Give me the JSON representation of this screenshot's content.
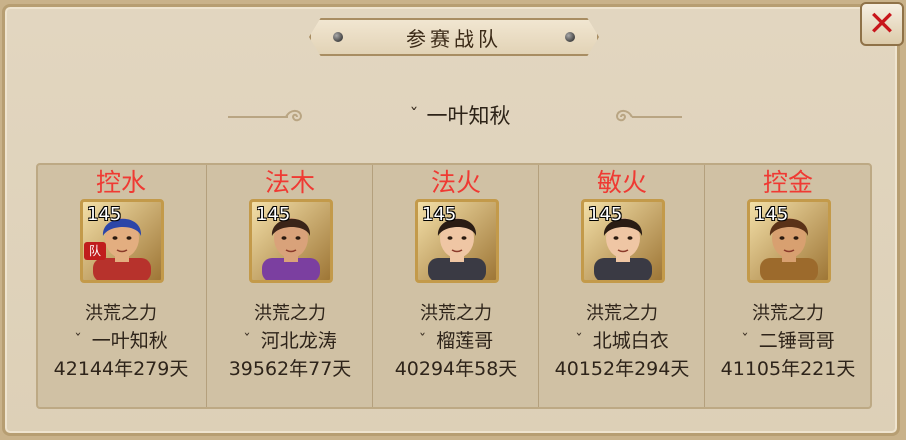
{
  "window": {
    "title": "参赛战队",
    "close_icon": "close-x-icon",
    "colors": {
      "accent": "#c8161c",
      "role_text": "#ef3a33",
      "panel_bg": "#ddd0b7"
    }
  },
  "team": {
    "flag_icon": "team-flag-icon",
    "name": "一叶知秋"
  },
  "members": [
    {
      "role": "控水",
      "level": "145",
      "badge": "队",
      "guild": "洪荒之力",
      "name": "一叶知秋",
      "time": "42144年279天",
      "hair": "#2c46a8",
      "skin": "#e3ae80",
      "robe": "#b7322c"
    },
    {
      "role": "法木",
      "level": "145",
      "guild": "洪荒之力",
      "name": "河北龙涛",
      "time": "39562年77天",
      "hair": "#3a2418",
      "skin": "#d9a27a",
      "robe": "#7b3fa0"
    },
    {
      "role": "法火",
      "level": "145",
      "guild": "洪荒之力",
      "name": "榴莲哥",
      "time": "40294年58天",
      "hair": "#2a1c14",
      "skin": "#efc6a4",
      "robe": "#3a3a44"
    },
    {
      "role": "敏火",
      "level": "145",
      "guild": "洪荒之力",
      "name": "北城白衣",
      "time": "40152年294天",
      "hair": "#2a1c14",
      "skin": "#efc6a4",
      "robe": "#3a3a44"
    },
    {
      "role": "控金",
      "level": "145",
      "guild": "洪荒之力",
      "name": "二锤哥哥",
      "time": "41105年221天",
      "hair": "#5a3218",
      "skin": "#d8a070",
      "robe": "#9c6a2c"
    }
  ]
}
